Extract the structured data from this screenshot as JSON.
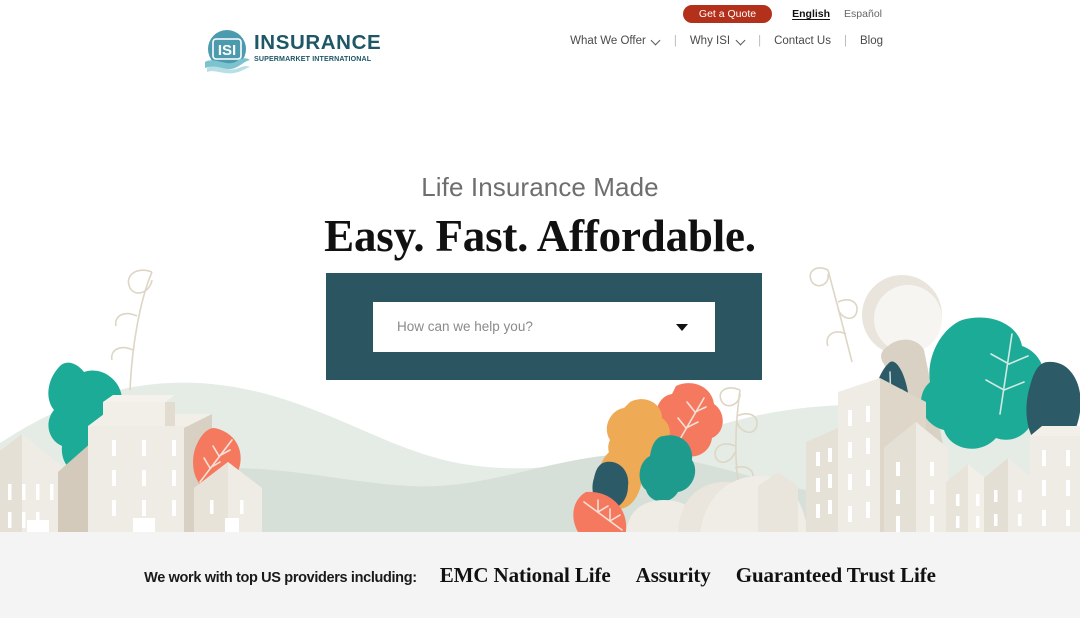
{
  "header": {
    "logo": {
      "mark_text": "ISI",
      "main": "INSURANCE",
      "sub": "SUPERMARKET INTERNATIONAL",
      "circle_color": "#4c9aae",
      "text_color": "#1e5766"
    },
    "quote_button": {
      "label": "Get a Quote",
      "color": "#b3311b"
    },
    "languages": [
      {
        "label": "English",
        "active": true
      },
      {
        "label": "Español",
        "active": false
      }
    ],
    "nav": [
      {
        "label": "What We Offer",
        "has_dropdown": true
      },
      {
        "label": "Why ISI",
        "has_dropdown": true
      },
      {
        "label": "Contact Us",
        "has_dropdown": false
      },
      {
        "label": "Blog",
        "has_dropdown": false
      }
    ],
    "separator": "|"
  },
  "hero": {
    "subtitle": "Life Insurance Made",
    "title": "Easy. Fast. Affordable."
  },
  "search": {
    "placeholder": "How can we help you?",
    "caret_icon": "chevron-down-icon",
    "panel_color": "#2b5560"
  },
  "providers": {
    "label": "We work with top US providers including:",
    "names": [
      "EMC National Life",
      "Assurity",
      "Guaranteed Trust Life"
    ],
    "bar_color": "#f4f4f4"
  },
  "illustration": {
    "palette": {
      "hill_light": "#e4ece5",
      "hill_dark": "#d6e0d7",
      "building_light": "#f0ede7",
      "building_mid": "#e2ddd3",
      "building_shade": "#cfc7ba",
      "teal_bright": "#1cab96",
      "teal_dark": "#2c5a66",
      "coral": "#f5795f",
      "orange": "#efaa55",
      "stem": "#ddd5c3"
    }
  }
}
